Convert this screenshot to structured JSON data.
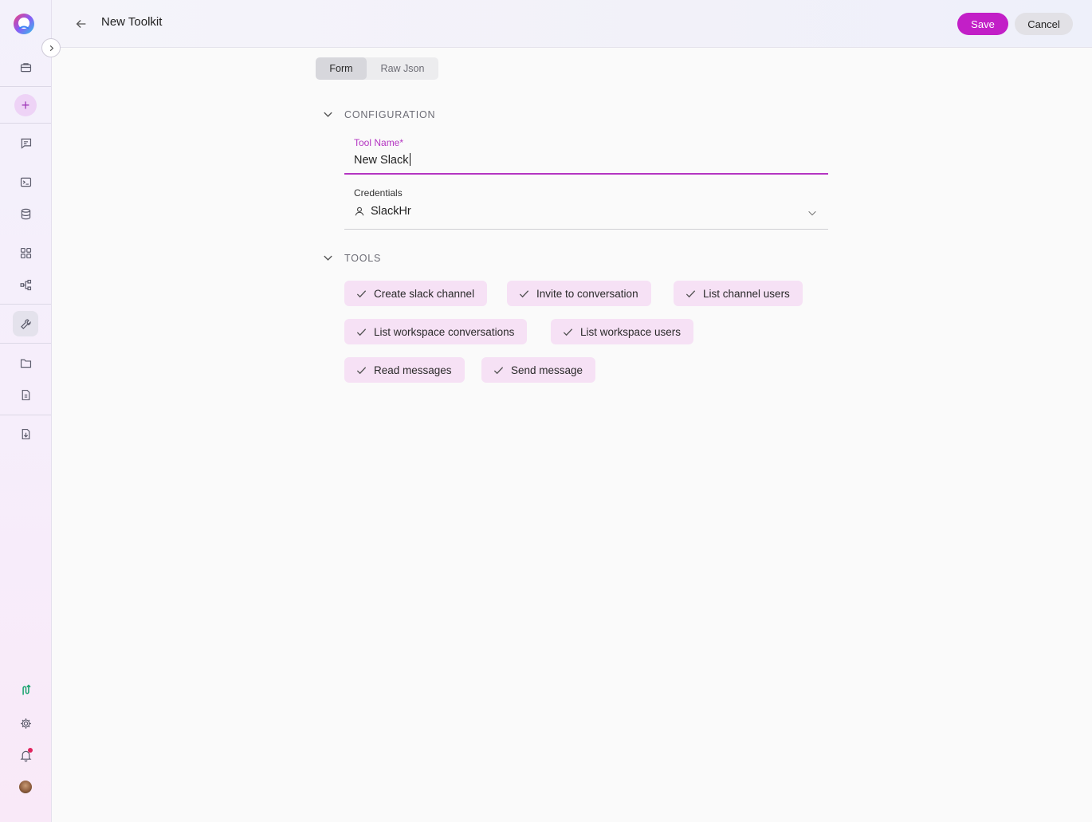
{
  "header": {
    "title": "New Toolkit",
    "save_label": "Save",
    "cancel_label": "Cancel"
  },
  "tabs": [
    {
      "label": "Form",
      "active": true
    },
    {
      "label": "Raw Json",
      "active": false
    }
  ],
  "sections": {
    "configuration": {
      "title": "CONFIGURATION",
      "tool_name": {
        "label": "Tool Name*",
        "value": "New Slack"
      },
      "credentials": {
        "label": "Credentials",
        "value": "SlackHr"
      }
    },
    "tools": {
      "title": "TOOLS",
      "items": [
        {
          "label": "Create slack channel",
          "checked": true
        },
        {
          "label": "Invite to conversation",
          "checked": true
        },
        {
          "label": "List channel users",
          "checked": true
        },
        {
          "label": "List workspace conversations",
          "checked": true
        },
        {
          "label": "List workspace users",
          "checked": true
        },
        {
          "label": "Read messages",
          "checked": true
        },
        {
          "label": "Send message",
          "checked": true
        }
      ]
    }
  },
  "sidebar": {
    "icons": [
      "logo",
      "briefcase-icon",
      "add-icon",
      "chat-icon",
      "terminal-icon",
      "database-icon",
      "apps-icon",
      "pipeline-icon",
      "wrench-icon",
      "folder-icon",
      "document-icon",
      "import-icon",
      "integration-icon",
      "settings-icon",
      "bell-icon",
      "avatar"
    ]
  },
  "colors": {
    "accent": "#c21fc7",
    "chip_bg": "#f6e1f5",
    "field_active": "#b435c2"
  }
}
